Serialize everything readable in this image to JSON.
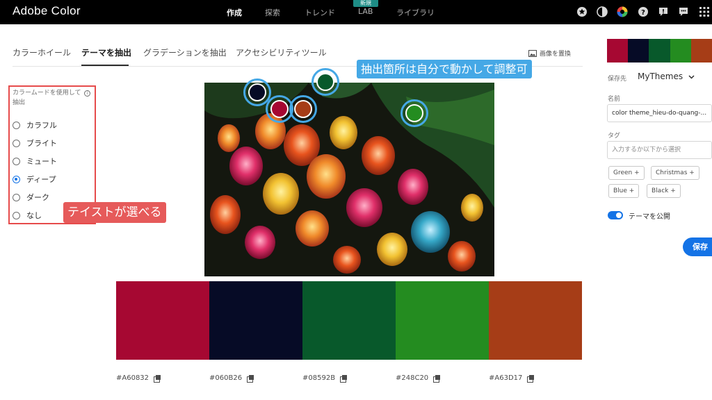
{
  "header": {
    "app_title": "Adobe Color",
    "nav": [
      "作成",
      "探索",
      "トレンド",
      "LAB",
      "ライブラリ"
    ],
    "nav_badge": "新規",
    "icons": [
      "award-icon",
      "contrast-icon",
      "color-wheel-icon",
      "help-icon",
      "feedback-icon",
      "chat-icon",
      "apps-grid-icon"
    ]
  },
  "tabs": {
    "items": [
      "カラーホイール",
      "テーマを抽出",
      "グラデーションを抽出",
      "アクセシビリティツール"
    ],
    "active_index": 1,
    "replace_image": "画像を置換"
  },
  "color_mood": {
    "title": "カラームードを使用して抽出",
    "info": "i",
    "options": [
      "カラフル",
      "ブライト",
      "ミュート",
      "ディープ",
      "ダーク",
      "なし"
    ],
    "selected": "ディープ"
  },
  "annotations": {
    "mood_callout": "テイストが選べる",
    "picker_callout": "抽出箇所は自分で動かして調整可"
  },
  "pickers": [
    {
      "color": "#060B26"
    },
    {
      "color": "#A60832"
    },
    {
      "color": "#A63D17"
    },
    {
      "color": "#08592B"
    },
    {
      "color": "#248C20"
    }
  ],
  "swatches": [
    {
      "hex": "#A60832",
      "color": "#A60832"
    },
    {
      "hex": "#060B26",
      "color": "#060B26"
    },
    {
      "hex": "#08592B",
      "color": "#08592B"
    },
    {
      "hex": "#248C20",
      "color": "#248C20"
    },
    {
      "hex": "#A63D17",
      "color": "#A63D17"
    }
  ],
  "side_panel": {
    "save_to_label": "保存先",
    "library": "MyThemes",
    "name_label": "名前",
    "name_value": "color theme_hieu-do-quang-...",
    "tags_label": "タグ",
    "tags_placeholder": "入力するか以下から選択",
    "tags": [
      "Green +",
      "Christmas +",
      "Blue +",
      "Black +"
    ],
    "publish_label": "テーマを公開",
    "publish_on": true,
    "save_button": "保存"
  }
}
